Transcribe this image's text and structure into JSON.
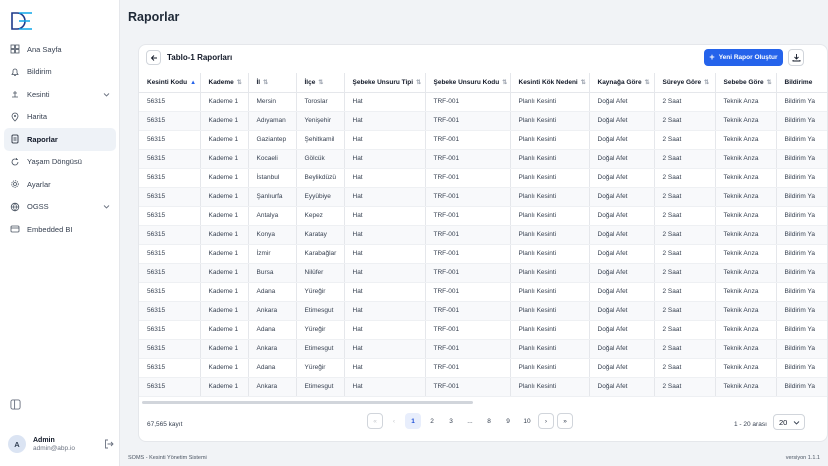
{
  "app": {
    "page_title": "Raporlar",
    "status_text": "SOMS - Kesinti Yönetim Sistemi",
    "version": "versiyon 1.1.1"
  },
  "sidebar": {
    "items": [
      {
        "label": "Ana Sayfa",
        "icon": "dashboard-icon"
      },
      {
        "label": "Bildirim",
        "icon": "bell-icon"
      },
      {
        "label": "Kesinti",
        "icon": "outage-icon",
        "expandable": true
      },
      {
        "label": "Harita",
        "icon": "map-icon"
      },
      {
        "label": "Raporlar",
        "icon": "report-icon",
        "active": true
      },
      {
        "label": "Yaşam Döngüsü",
        "icon": "cycle-icon"
      },
      {
        "label": "Ayarlar",
        "icon": "gear-icon"
      },
      {
        "label": "OGSS",
        "icon": "globe-icon",
        "expandable": true
      },
      {
        "label": "Embedded BI",
        "icon": "bi-icon"
      }
    ],
    "user": {
      "initial": "A",
      "name": "Admin",
      "email": "admin@abp.io"
    }
  },
  "card": {
    "title": "Tablo-1 Raporları",
    "new_report_label": "Yeni Rapor Oluştur"
  },
  "table": {
    "columns": [
      "Kesinti Kodu",
      "Kademe",
      "İl",
      "İlçe",
      "Şebeke Unsuru Tipi",
      "Şebeke Unsuru Kodu",
      "Kesinti Kök Nedeni",
      "Kaynağa Göre",
      "Süreye Göre",
      "Sebebe Göre",
      "Bildirime"
    ],
    "rows": [
      [
        "56315",
        "Kademe 1",
        "Mersin",
        "Toroslar",
        "Hat",
        "TRF-001",
        "Planlı Kesinti",
        "Doğal Afet",
        "2 Saat",
        "Teknik Arıza",
        "Bildirim Ya"
      ],
      [
        "56315",
        "Kademe 1",
        "Adıyaman",
        "Yenişehir",
        "Hat",
        "TRF-001",
        "Planlı Kesinti",
        "Doğal Afet",
        "2 Saat",
        "Teknik Arıza",
        "Bildirim Ya"
      ],
      [
        "56315",
        "Kademe 1",
        "Gaziantep",
        "Şehitkamil",
        "Hat",
        "TRF-001",
        "Planlı Kesinti",
        "Doğal Afet",
        "2 Saat",
        "Teknik Arıza",
        "Bildirim Ya"
      ],
      [
        "56315",
        "Kademe 1",
        "Kocaeli",
        "Gölcük",
        "Hat",
        "TRF-001",
        "Planlı Kesinti",
        "Doğal Afet",
        "2 Saat",
        "Teknik Arıza",
        "Bildirim Ya"
      ],
      [
        "56315",
        "Kademe 1",
        "İstanbul",
        "Beylikdüzü",
        "Hat",
        "TRF-001",
        "Planlı Kesinti",
        "Doğal Afet",
        "2 Saat",
        "Teknik Arıza",
        "Bildirim Ya"
      ],
      [
        "56315",
        "Kademe 1",
        "Şanlıurfa",
        "Eyyübiye",
        "Hat",
        "TRF-001",
        "Planlı Kesinti",
        "Doğal Afet",
        "2 Saat",
        "Teknik Arıza",
        "Bildirim Ya"
      ],
      [
        "56315",
        "Kademe 1",
        "Antalya",
        "Kepez",
        "Hat",
        "TRF-001",
        "Planlı Kesinti",
        "Doğal Afet",
        "2 Saat",
        "Teknik Arıza",
        "Bildirim Ya"
      ],
      [
        "56315",
        "Kademe 1",
        "Konya",
        "Karatay",
        "Hat",
        "TRF-001",
        "Planlı Kesinti",
        "Doğal Afet",
        "2 Saat",
        "Teknik Arıza",
        "Bildirim Ya"
      ],
      [
        "56315",
        "Kademe 1",
        "İzmir",
        "Karabağlar",
        "Hat",
        "TRF-001",
        "Planlı Kesinti",
        "Doğal Afet",
        "2 Saat",
        "Teknik Arıza",
        "Bildirim Ya"
      ],
      [
        "56315",
        "Kademe 1",
        "Bursa",
        "Nilüfer",
        "Hat",
        "TRF-001",
        "Planlı Kesinti",
        "Doğal Afet",
        "2 Saat",
        "Teknik Arıza",
        "Bildirim Ya"
      ],
      [
        "56315",
        "Kademe 1",
        "Adana",
        "Yüreğir",
        "Hat",
        "TRF-001",
        "Planlı Kesinti",
        "Doğal Afet",
        "2 Saat",
        "Teknik Arıza",
        "Bildirim Ya"
      ],
      [
        "56315",
        "Kademe 1",
        "Ankara",
        "Etimesgut",
        "Hat",
        "TRF-001",
        "Planlı Kesinti",
        "Doğal Afet",
        "2 Saat",
        "Teknik Arıza",
        "Bildirim Ya"
      ],
      [
        "56315",
        "Kademe 1",
        "Adana",
        "Yüreğir",
        "Hat",
        "TRF-001",
        "Planlı Kesinti",
        "Doğal Afet",
        "2 Saat",
        "Teknik Arıza",
        "Bildirim Ya"
      ],
      [
        "56315",
        "Kademe 1",
        "Ankara",
        "Etimesgut",
        "Hat",
        "TRF-001",
        "Planlı Kesinti",
        "Doğal Afet",
        "2 Saat",
        "Teknik Arıza",
        "Bildirim Ya"
      ],
      [
        "56315",
        "Kademe 1",
        "Adana",
        "Yüreğir",
        "Hat",
        "TRF-001",
        "Planlı Kesinti",
        "Doğal Afet",
        "2 Saat",
        "Teknik Arıza",
        "Bildirim Ya"
      ],
      [
        "56315",
        "Kademe 1",
        "Ankara",
        "Etimesgut",
        "Hat",
        "TRF-001",
        "Planlı Kesinti",
        "Doğal Afet",
        "2 Saat",
        "Teknik Arıza",
        "Bildirim Ya"
      ]
    ]
  },
  "footer": {
    "record_count": "67,565 kayıt",
    "pages": [
      "1",
      "2",
      "3",
      "...",
      "8",
      "9",
      "10"
    ],
    "current_page": "1",
    "range_text": "1 - 20 arası",
    "page_size": "20"
  },
  "colors": {
    "accent": "#2563eb",
    "active_nav": "#eef2f7",
    "background": "#f1f3f6"
  }
}
